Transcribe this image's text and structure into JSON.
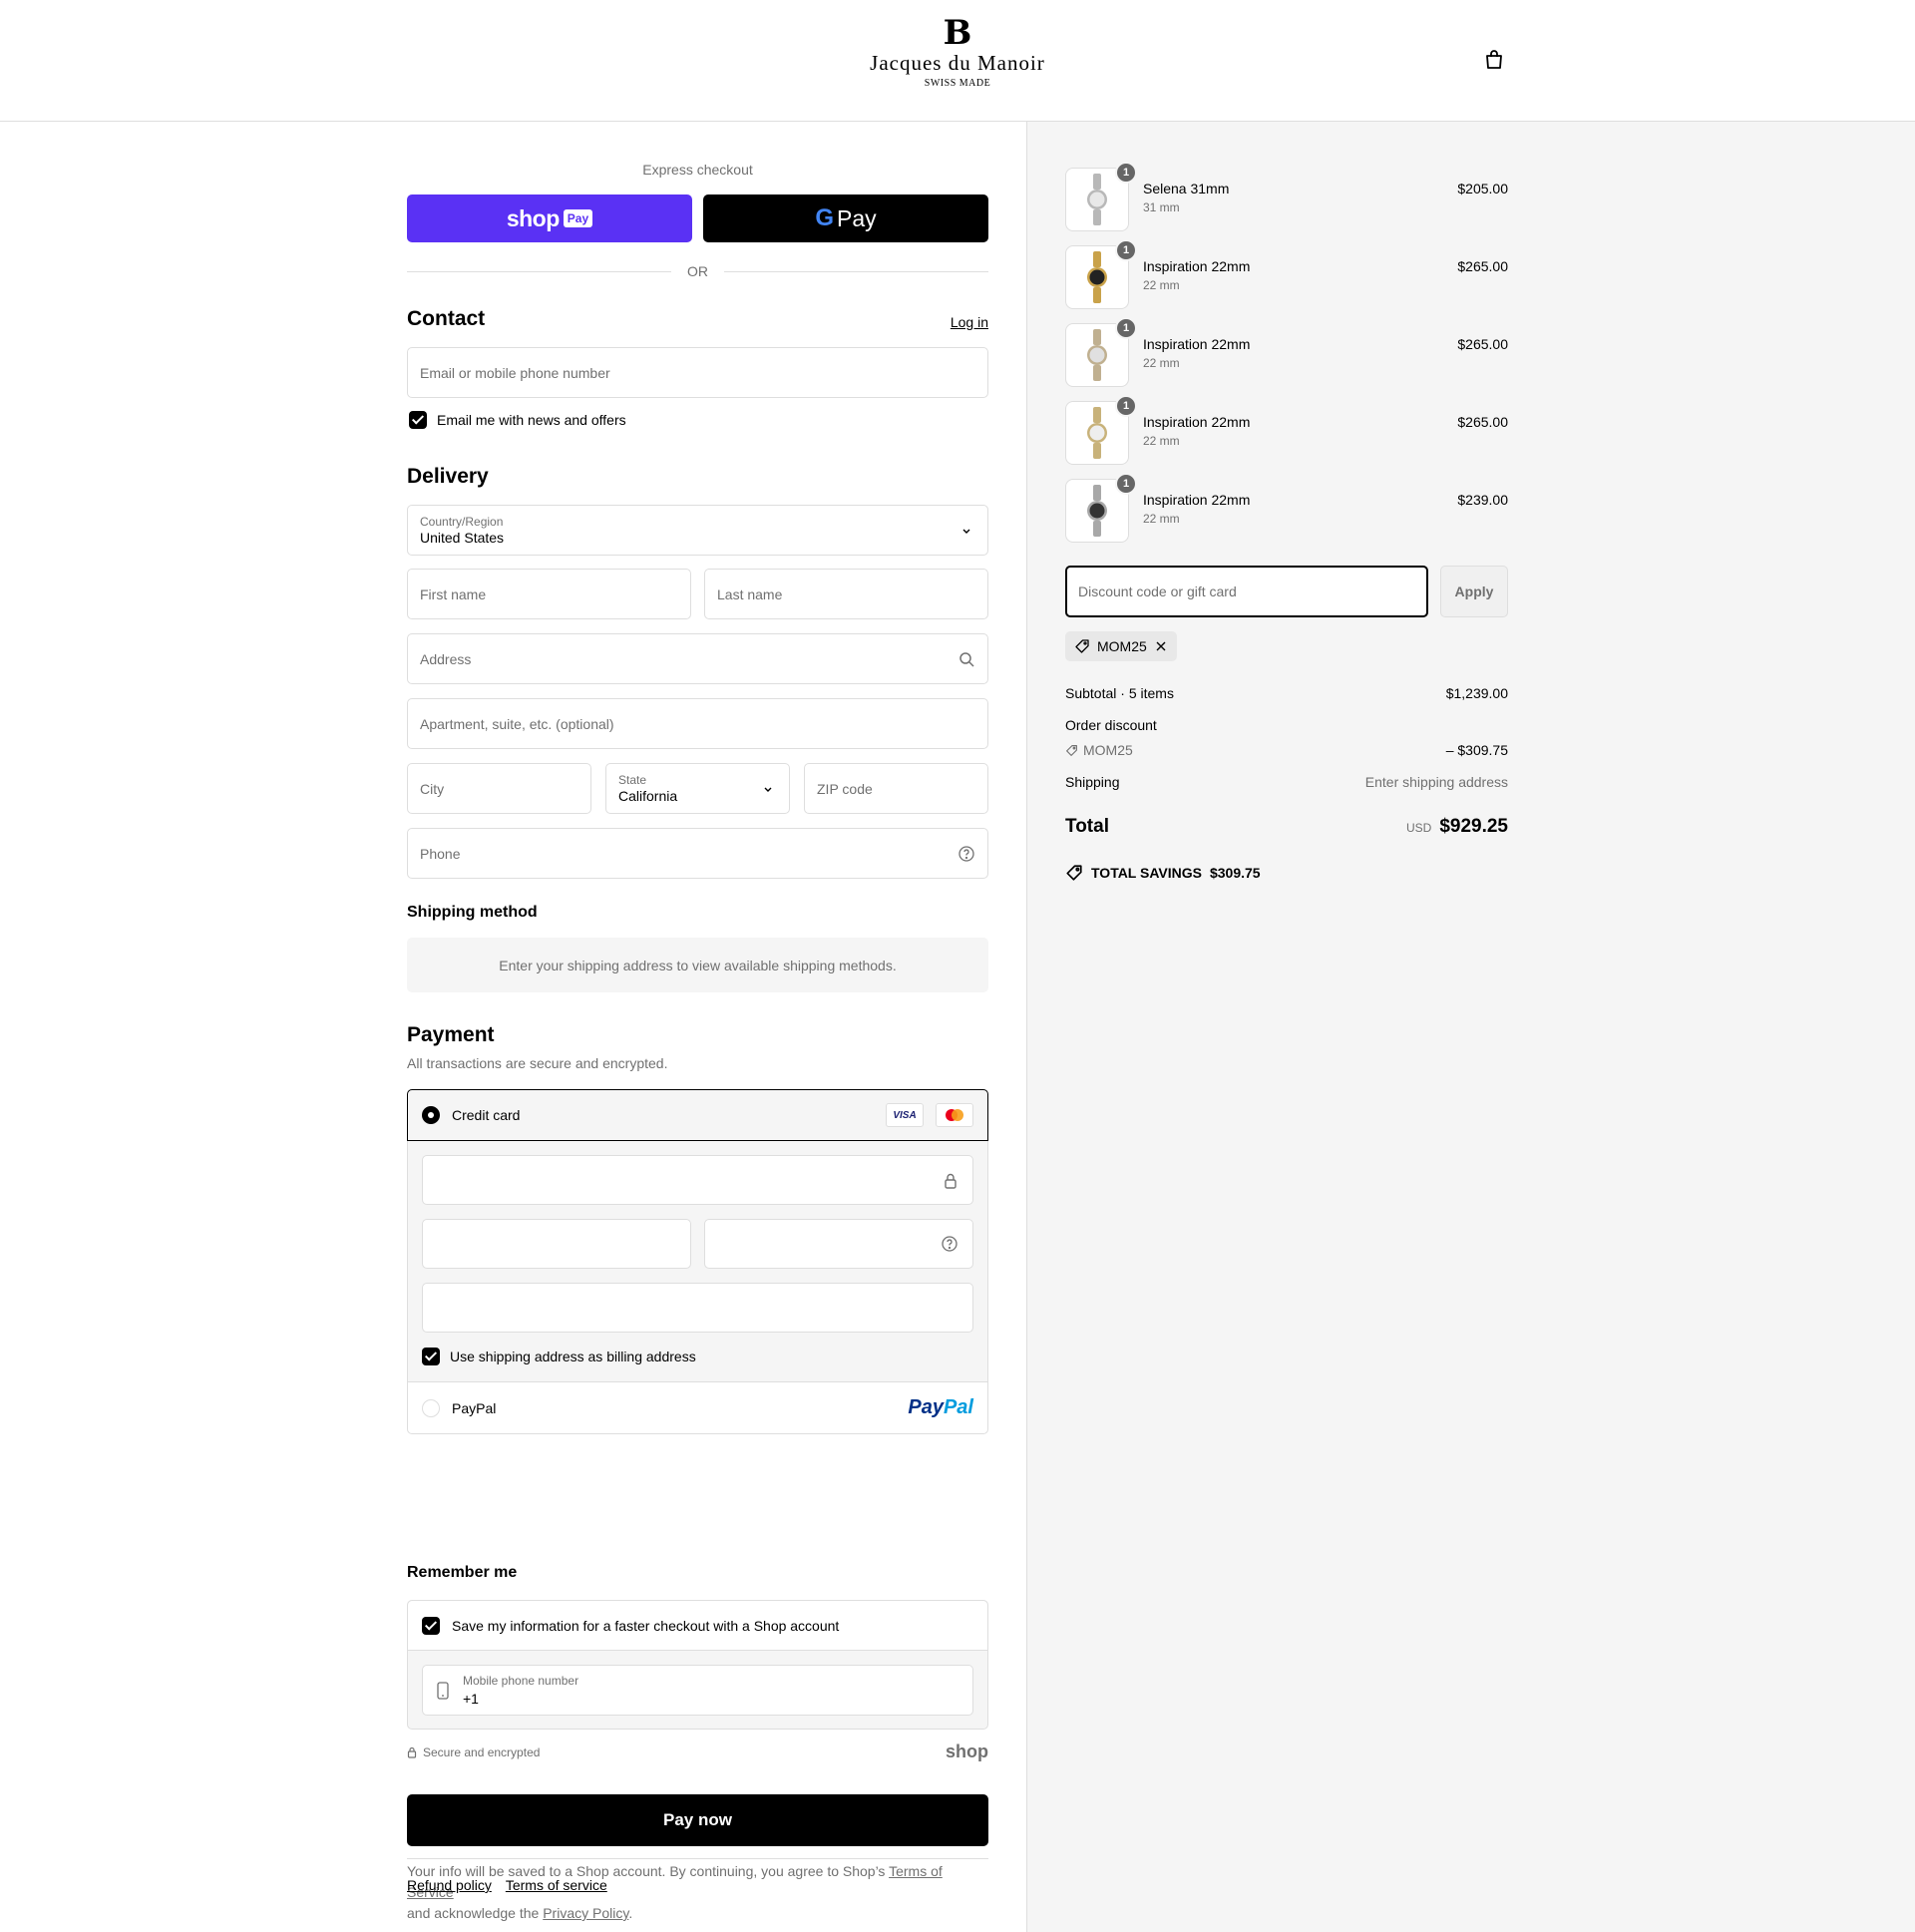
{
  "brand": {
    "crest": "B",
    "name": "Jacques du Manoir",
    "tagline": "SWISS MADE"
  },
  "express": {
    "label": "Express checkout",
    "shop_pay_word": "shop",
    "shop_pay_badge": "Pay",
    "gpay_g": "G",
    "gpay_word": "Pay",
    "or": "OR"
  },
  "contact": {
    "title": "Contact",
    "login": "Log in",
    "email_placeholder": "Email or mobile phone number",
    "news_label": "Email me with news and offers"
  },
  "delivery": {
    "title": "Delivery",
    "country_label": "Country/Region",
    "country_value": "United States",
    "first_name": "First name",
    "last_name": "Last name",
    "address": "Address",
    "apartment": "Apartment, suite, etc. (optional)",
    "city": "City",
    "state_label": "State",
    "state_value": "California",
    "zip": "ZIP code",
    "phone": "Phone"
  },
  "shipping_method": {
    "title": "Shipping method",
    "message": "Enter your shipping address to view available shipping methods."
  },
  "payment": {
    "title": "Payment",
    "subtitle": "All transactions are secure and encrypted.",
    "credit_card": "Credit card",
    "visa": "VISA",
    "billing_label": "Use shipping address as billing address",
    "paypal": "PayPal",
    "paypal_logo_a": "Pay",
    "paypal_logo_b": "Pal"
  },
  "remember": {
    "title": "Remember me",
    "save_label": "Save my information for a faster checkout with a Shop account",
    "mobile_label": "Mobile phone number",
    "mobile_value": "+1"
  },
  "secure": {
    "label": "Secure and encrypted",
    "shop_mark": "shop"
  },
  "pay_now": "Pay now",
  "legal": {
    "text_1": "Your info will be saved to a Shop account. By continuing, you agree to Shop’s ",
    "tos": "Terms of Service",
    "text_2": " and acknowledge the ",
    "privacy": "Privacy Policy",
    "text_3": "."
  },
  "footer": {
    "refund": "Refund policy",
    "terms": "Terms of service"
  },
  "cart": {
    "items": [
      {
        "qty": "1",
        "name": "Selena 31mm",
        "variant": "31 mm",
        "price": "$205.00",
        "dial": "#e8e8e8",
        "band": "#b8b8b8"
      },
      {
        "qty": "1",
        "name": "Inspiration 22mm",
        "variant": "22 mm",
        "price": "$265.00",
        "dial": "#222222",
        "band": "#c9a24a"
      },
      {
        "qty": "1",
        "name": "Inspiration 22mm",
        "variant": "22 mm",
        "price": "$265.00",
        "dial": "#e0e0e0",
        "band": "#c0b090"
      },
      {
        "qty": "1",
        "name": "Inspiration 22mm",
        "variant": "22 mm",
        "price": "$265.00",
        "dial": "#eeeeee",
        "band": "#c8b27a"
      },
      {
        "qty": "1",
        "name": "Inspiration 22mm",
        "variant": "22 mm",
        "price": "$239.00",
        "dial": "#333333",
        "band": "#a8a8a8"
      }
    ],
    "discount_placeholder": "Discount code or gift card",
    "apply": "Apply",
    "code": "MOM25",
    "subtotal_label": "Subtotal · 5 items",
    "subtotal_value": "$1,239.00",
    "order_discount_label": "Order discount",
    "discount_code": "MOM25",
    "discount_value": "– $309.75",
    "shipping_label": "Shipping",
    "shipping_value": "Enter shipping address",
    "total_label": "Total",
    "currency": "USD",
    "total_value": "$929.25",
    "savings_label": "TOTAL SAVINGS",
    "savings_value": "$309.75"
  },
  "colors": {
    "shop_pay": "#5a31f4",
    "primary": "#000000",
    "summary_bg": "#f5f5f5",
    "border": "#dedede",
    "muted_text": "#707070"
  }
}
